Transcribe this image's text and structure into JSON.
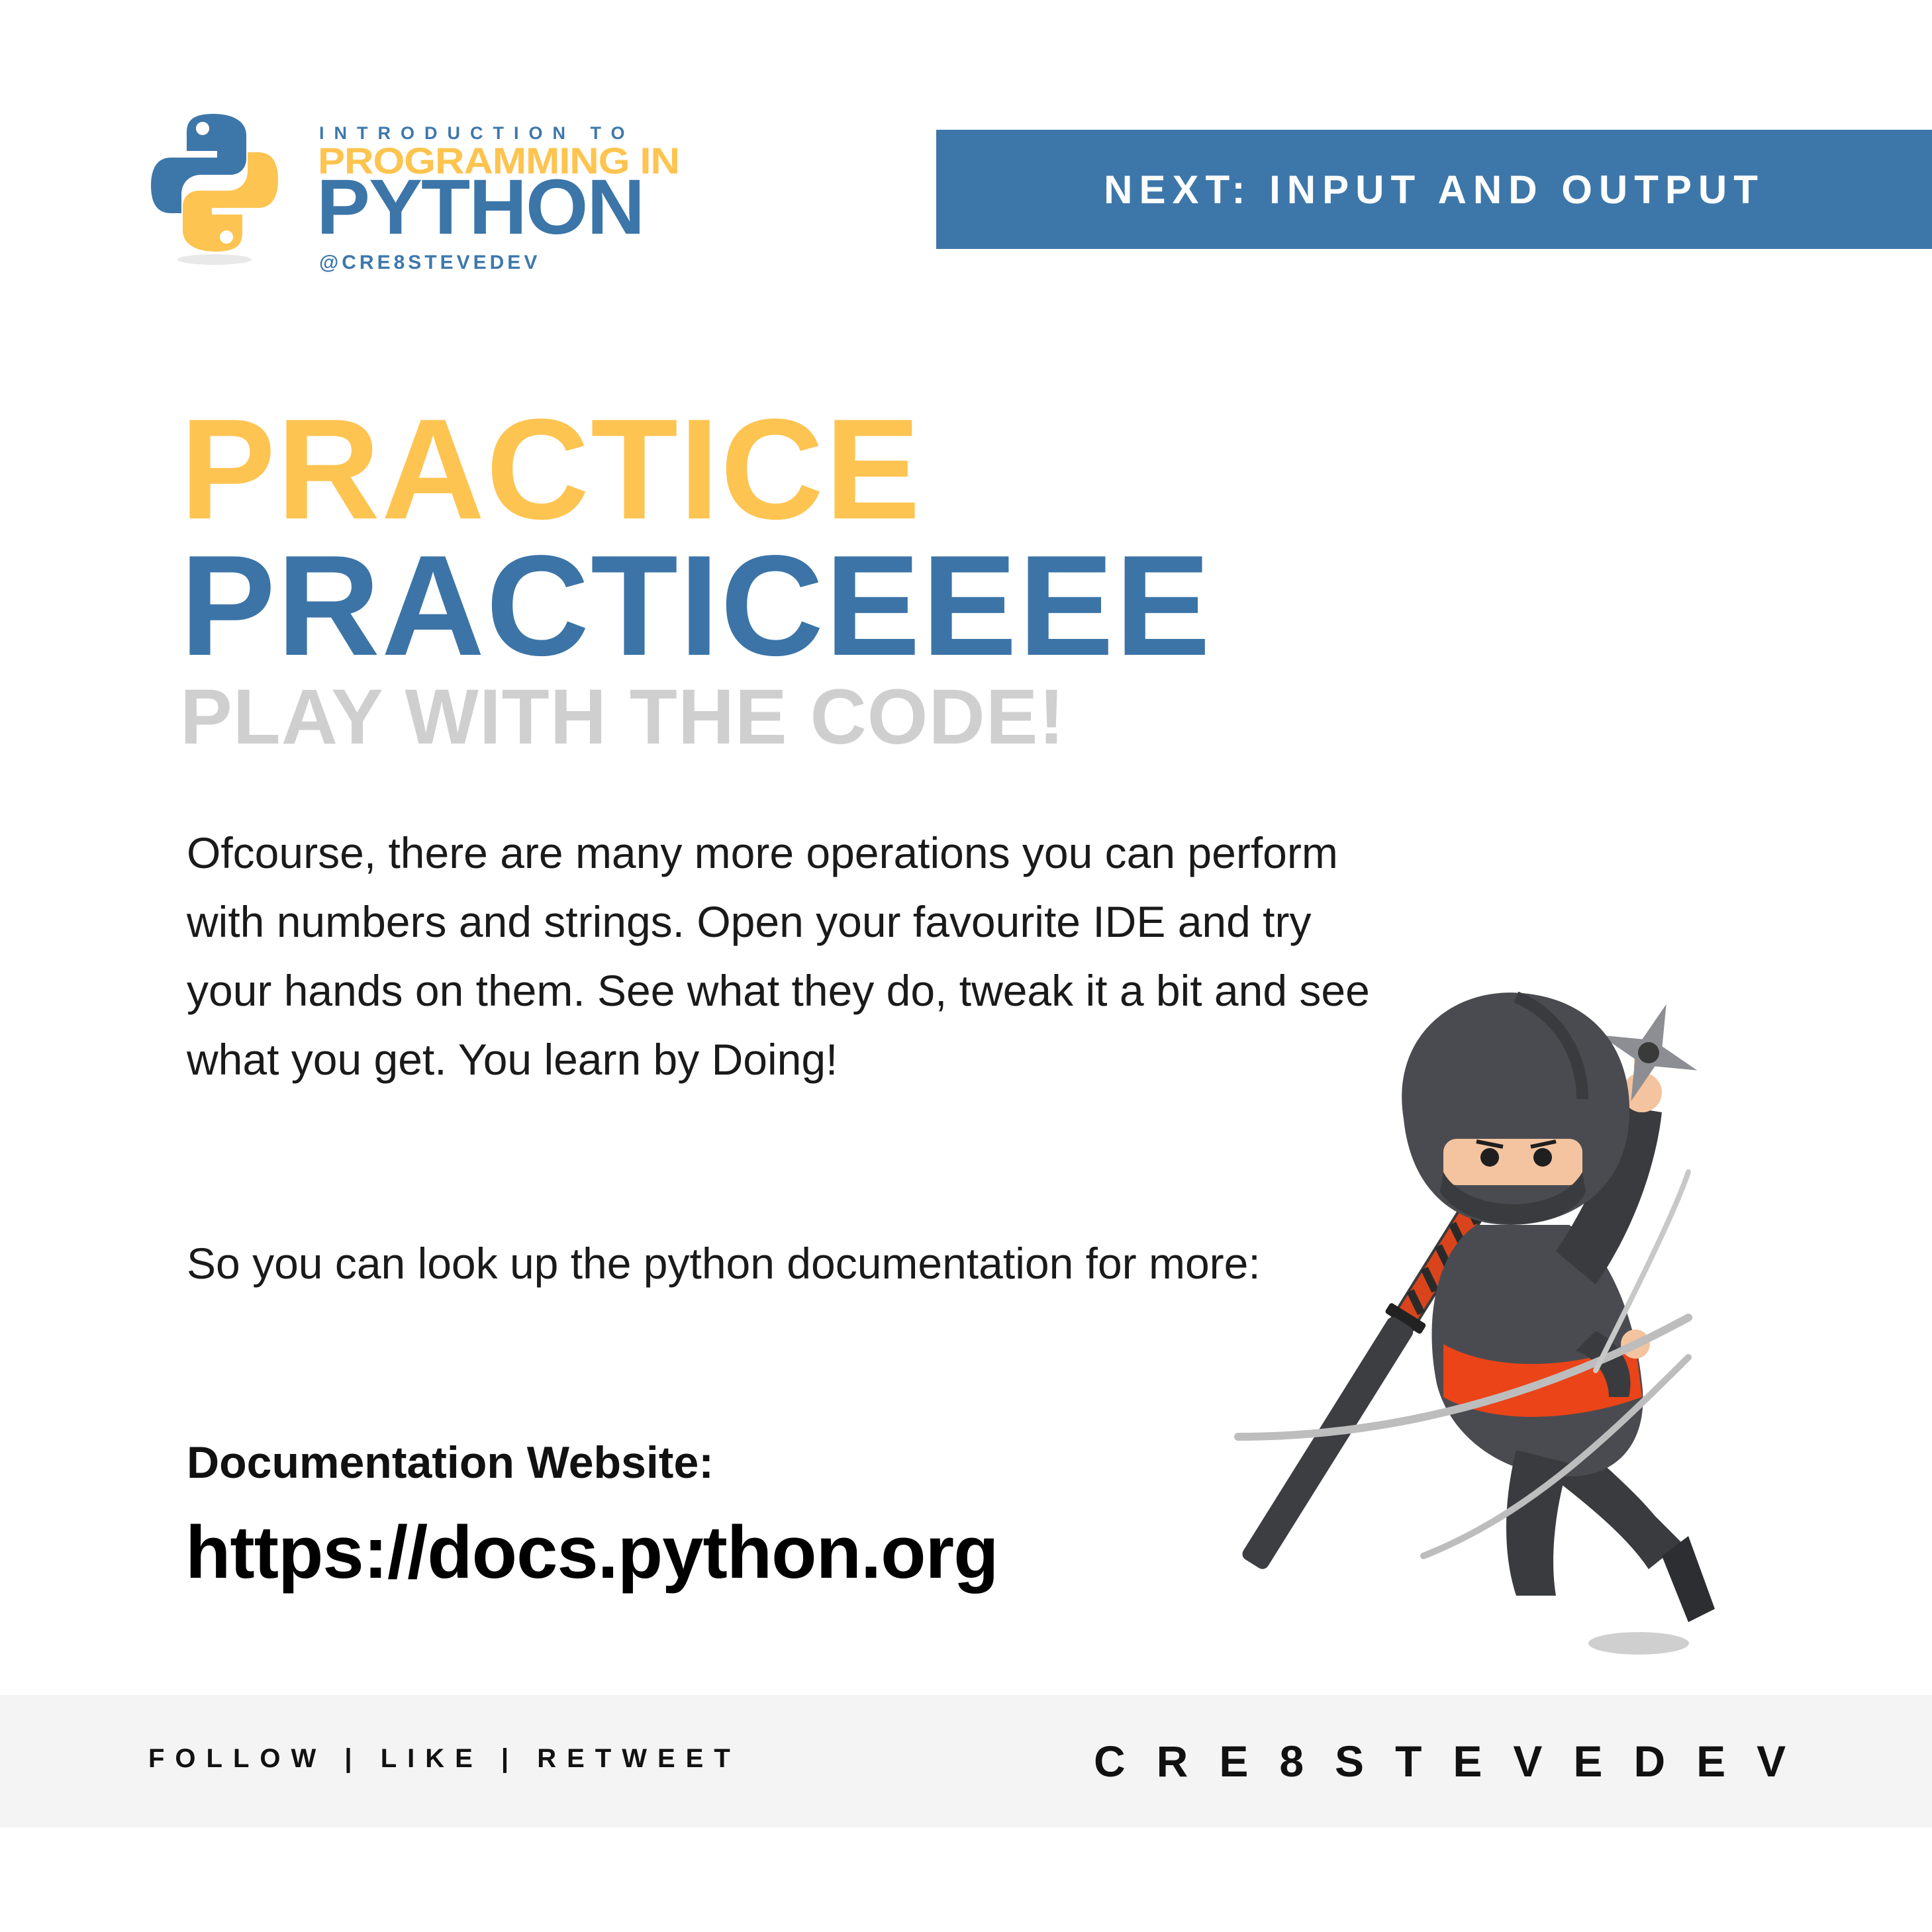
{
  "header": {
    "series_prefix": "INTRODUCTION TO",
    "series_middle": "PROGRAMMING IN",
    "series_main": "PYTHON",
    "series_handle": "@CRE8STEVEDEV",
    "logo_icon": "python-logo-icon"
  },
  "next_banner": {
    "label": "NEXT: INPUT AND OUTPUT"
  },
  "headline": {
    "line1": "PRACTICE",
    "line2": "PRACTICEEEE",
    "subtitle": "PLAY WITH THE CODE!"
  },
  "body": {
    "paragraph1": "Ofcourse, there are many more operations you can perform with numbers and strings. Open your favourite IDE and try your hands on them. See what they do, tweak it a bit and see what you get. You learn by Doing!",
    "paragraph2": "So you can look up the python documentation for more:",
    "doc_label": "Documentation Website:",
    "doc_url": "https://docs.python.org"
  },
  "illustration": {
    "icon": "ninja-illustration"
  },
  "footer": {
    "left": "FOLLOW | LIKE | RETWEET",
    "right": "CRE8STEVEDEV"
  },
  "colors": {
    "yellow": "#fec451",
    "blue": "#3c75a8",
    "grey_text": "#cfcfcf",
    "footer_bg": "#f4f4f4"
  }
}
